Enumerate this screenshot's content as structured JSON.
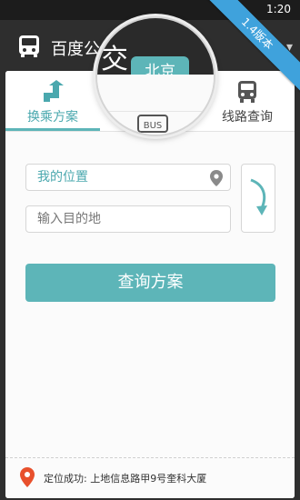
{
  "status_bar": {
    "time": "1:20"
  },
  "ribbon": {
    "label": "1.4版本"
  },
  "header": {
    "title": "百度公交",
    "title_visible": "百度公"
  },
  "magnifier": {
    "big_char": "交",
    "city": "北京",
    "bus_text": "BUS"
  },
  "tabs": [
    {
      "label": "换乘方案",
      "icon": "transfer-arrow-icon",
      "active": true
    },
    {
      "label": "线路查询",
      "icon": "bus-icon",
      "active": false
    }
  ],
  "form": {
    "origin_value": "我的位置",
    "destination_placeholder": "输入目的地"
  },
  "query_button": {
    "label": "查询方案"
  },
  "location": {
    "text": "定位成功: 上地信息路甲9号奎科大厦"
  },
  "colors": {
    "accent": "#5db5b8",
    "dark": "#2e2e2e",
    "pin": "#e8502c",
    "ribbon": "#3fa2dc"
  }
}
